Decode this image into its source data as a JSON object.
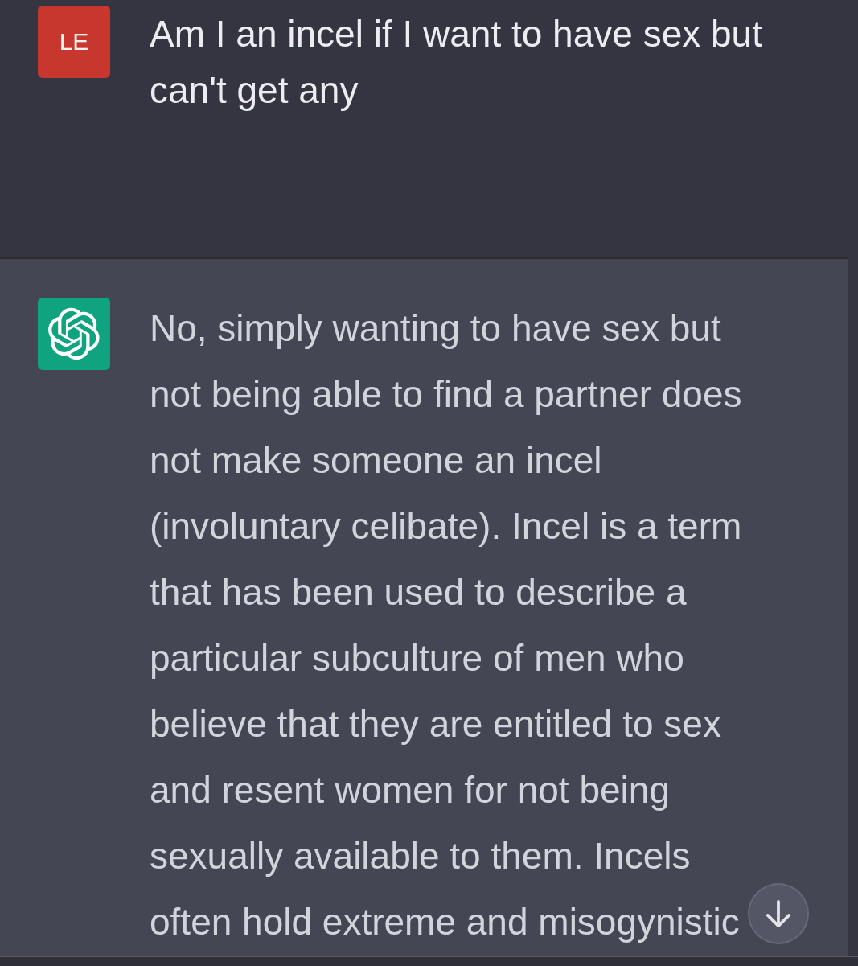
{
  "messages": [
    {
      "kind": "user",
      "avatar": "LE",
      "text": "Am I an incel if I want to have sex but can't get any"
    },
    {
      "kind": "assistant",
      "text": "No, simply wanting to have sex but not being able to find a partner does not make someone an incel (involuntary celibate). Incel is a term that has been used to describe a particular subculture of men who believe that they are entitled to sex and resent women for not being sexually available to them. Incels often hold extreme and misogynistic"
    }
  ]
}
